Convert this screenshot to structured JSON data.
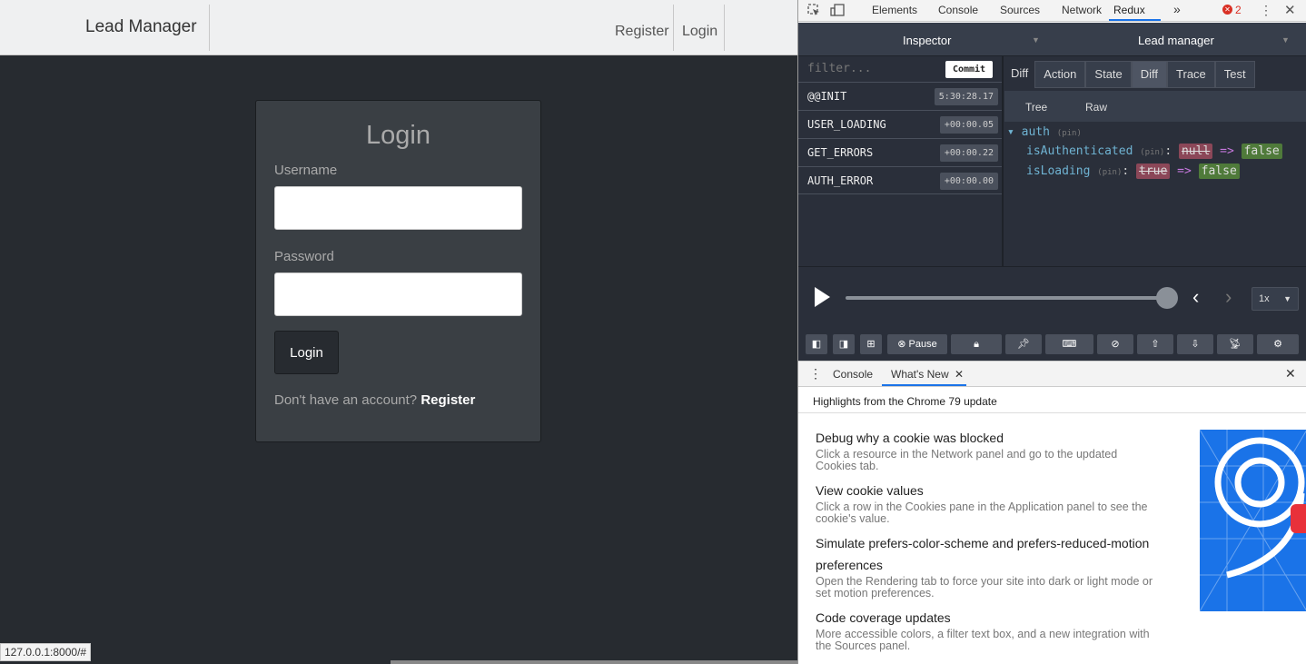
{
  "app": {
    "brand": "Lead Manager",
    "nav": {
      "register": "Register",
      "login": "Login"
    },
    "card": {
      "title": "Login",
      "username_label": "Username",
      "password_label": "Password",
      "login_button": "Login",
      "register_prompt": "Don't have an account?",
      "register_link": "Register"
    },
    "status_url": "127.0.0.1:8000/#"
  },
  "devtools": {
    "tabs": [
      "Elements",
      "Console",
      "Sources",
      "Network",
      "Redux"
    ],
    "active_tab": "Redux",
    "more": "»",
    "error_count": "2",
    "redux": {
      "inspector_label": "Inspector",
      "instance_label": "Lead manager",
      "filter_placeholder": "filter...",
      "commit_label": "Commit",
      "actions": [
        {
          "name": "@@INIT",
          "time": "5:30:28.17"
        },
        {
          "name": "USER_LOADING",
          "time": "+00:00.05"
        },
        {
          "name": "GET_ERRORS",
          "time": "+00:00.22"
        },
        {
          "name": "AUTH_ERROR",
          "time": "+00:00.00"
        }
      ],
      "mode_tabs": [
        "Diff",
        "Action",
        "State",
        "Diff",
        "Trace",
        "Test"
      ],
      "active_mode": "Diff",
      "sub_tabs": [
        "Tree",
        "Raw"
      ],
      "tree": {
        "root": "auth",
        "pin": "(pin)",
        "rows": [
          {
            "key": "isAuthenticated",
            "old": "null",
            "new": "false"
          },
          {
            "key": "isLoading",
            "old": "true",
            "new": "false"
          }
        ],
        "arrow": "=>"
      },
      "speed": "1x",
      "pause_label": "Pause",
      "slider_position": 1.0
    },
    "drawer": {
      "tabs": [
        "Console",
        "What's New"
      ],
      "active_tab": "What's New",
      "highlight": "Highlights from the Chrome 79 update",
      "items": [
        {
          "title": "Debug why a cookie was blocked",
          "desc": "Click a resource in the Network panel and go to the updated Cookies tab."
        },
        {
          "title": "View cookie values",
          "desc": "Click a row in the Cookies pane in the Application panel to see the cookie's value."
        },
        {
          "title": "Simulate prefers-color-scheme and prefers-reduced-motion preferences",
          "desc": "Open the Rendering tab to force your site into dark or light mode or set motion preferences."
        },
        {
          "title": "Code coverage updates",
          "desc": "More accessible colors, a filter text box, and a new integration with the Sources panel."
        }
      ]
    }
  },
  "colors": {
    "page_bg": "#272b30",
    "card_bg": "#3a3f44",
    "navbar_bg": "#eff0f1",
    "redux_bg": "#2a2f3a",
    "diff_removed": "#8b4758",
    "diff_added": "#4f7a3a",
    "accent": "#1a73e8"
  }
}
